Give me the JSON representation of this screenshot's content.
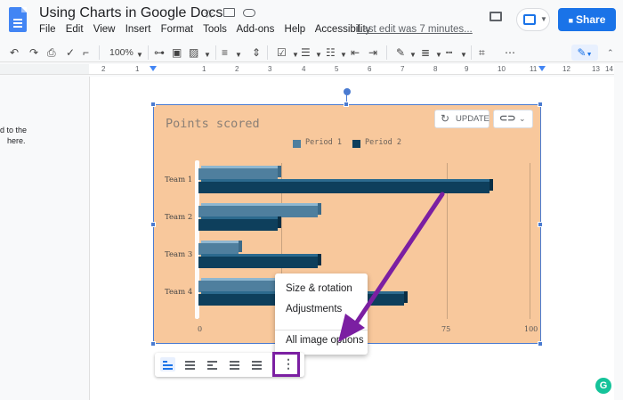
{
  "header": {
    "title": "Using Charts in Google Docs",
    "menu": [
      "File",
      "Edit",
      "View",
      "Insert",
      "Format",
      "Tools",
      "Add-ons",
      "Help",
      "Accessibility"
    ],
    "last_edit": "Last edit was 7 minutes...",
    "share_label": "Share"
  },
  "toolbar": {
    "zoom": "100%"
  },
  "ruler": {
    "ticks": [
      "2",
      "1",
      "1",
      "2",
      "3",
      "4",
      "5",
      "6",
      "7",
      "8",
      "9",
      "10",
      "11",
      "12",
      "13",
      "14",
      "15"
    ]
  },
  "page": {
    "side_text_1": "d to the",
    "side_text_2": "here."
  },
  "chart_controls": {
    "update_label": "UPDATE"
  },
  "chart_data": {
    "type": "bar",
    "orientation": "horizontal",
    "title": "Points scored",
    "categories": [
      "Team 1",
      "Team 2",
      "Team 3",
      "Team 4"
    ],
    "series": [
      {
        "name": "Period 1",
        "values": [
          24,
          36,
          12,
          24
        ],
        "color": "#4f7f9e"
      },
      {
        "name": "Period 2",
        "values": [
          88,
          24,
          36,
          62
        ],
        "color": "#0e3f5c"
      }
    ],
    "x_ticks": [
      "0",
      "75",
      "100"
    ],
    "xlim": [
      0,
      100
    ],
    "grid": true,
    "legend_position": "top"
  },
  "context_menu": {
    "items": [
      "Size & rotation",
      "Adjustments",
      "All image options"
    ]
  },
  "image_options": {
    "more_icon": "⋮"
  },
  "colors": {
    "chart_background": "#f8c89c",
    "accent": "#1a73e8",
    "highlight": "#7b1fa2"
  }
}
